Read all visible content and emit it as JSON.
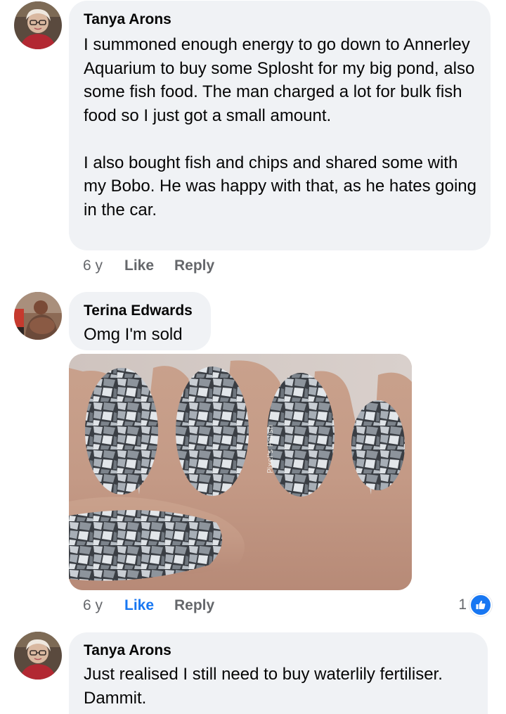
{
  "comments": [
    {
      "author": "Tanya Arons",
      "paragraphs": [
        "I summoned enough energy to go down to Annerley Aquarium to buy some Splosht for my big pond, also some fish food.  The man charged a lot for bulk fish food so I just got a small amount.",
        "I also bought fish and chips and shared some with my Bobo. He was happy with that, as he hates going in the car."
      ],
      "time": "6 y",
      "like_label": "Like",
      "reply_label": "Reply"
    },
    {
      "author": "Terina Edwards",
      "text": "Omg I'm sold",
      "photo": {
        "icon": "glitter-nail-polish-photo",
        "watermark": "Pixel's Polish"
      },
      "time": "6 y",
      "like_label": "Like",
      "reply_label": "Reply",
      "liked": true,
      "reaction_count": "1"
    },
    {
      "author": "Tanya Arons",
      "text": "Just realised I still need to buy waterlily fertiliser. Dammit."
    }
  ],
  "colors": {
    "bubble": "#f0f2f5",
    "meta": "#65676b",
    "accent": "#1877f2",
    "text": "#050505"
  }
}
